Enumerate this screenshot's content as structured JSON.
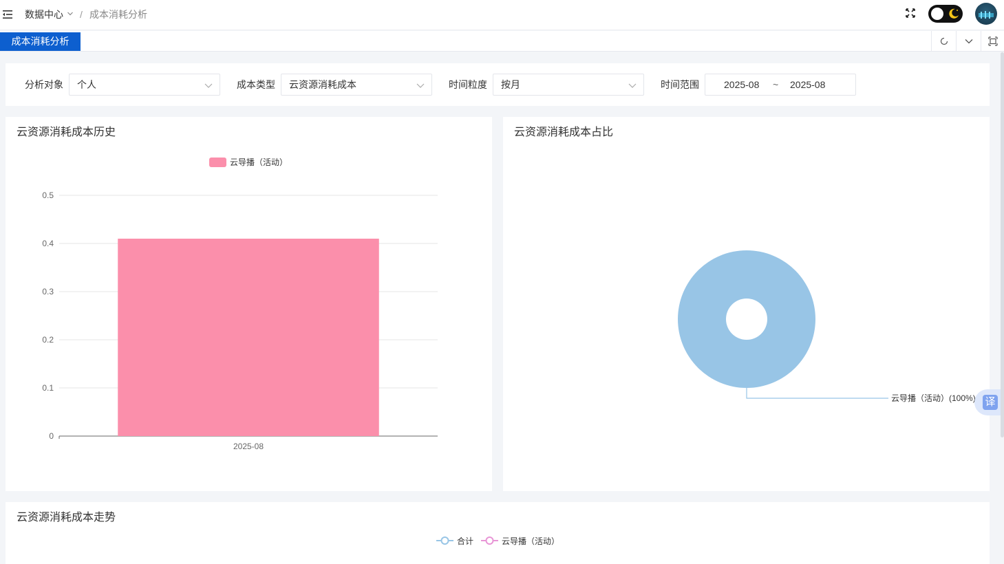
{
  "header": {
    "breadcrumb_root": "数据中心",
    "breadcrumb_sep": "/",
    "breadcrumb_current": "成本消耗分析"
  },
  "tabs": [
    {
      "label": "成本消耗分析",
      "active": true
    }
  ],
  "filters": {
    "target_label": "分析对象",
    "target_value": "个人",
    "cost_type_label": "成本类型",
    "cost_type_value": "云资源消耗成本",
    "granularity_label": "时间粒度",
    "granularity_value": "按月",
    "range_label": "时间范围",
    "range_start": "2025-08",
    "range_sep": "~",
    "range_end": "2025-08"
  },
  "colors": {
    "accent": "#0d5fcf",
    "bar": "#fb8fab",
    "pie": "#98c5e6",
    "line_total": "#98c5e6",
    "line_series": "#e895d6"
  },
  "translate_label": "译",
  "chart_data": [
    {
      "type": "bar",
      "title": "云资源消耗成本历史",
      "categories": [
        "2025-08"
      ],
      "series": [
        {
          "name": "云导播（活动）",
          "values": [
            0.41
          ]
        }
      ],
      "yticks": [
        "0",
        "0.1",
        "0.2",
        "0.3",
        "0.4",
        "0.5"
      ],
      "ylim": [
        0,
        0.5
      ],
      "grid": true,
      "legend": "top-center"
    },
    {
      "type": "pie",
      "title": "云资源消耗成本占比",
      "slices": [
        {
          "name": "云导播（活动）",
          "value": 100,
          "label": "云导播（活动）(100%)"
        }
      ],
      "legend": "none"
    },
    {
      "type": "line",
      "title": "云资源消耗成本走势",
      "series": [
        {
          "name": "合计"
        },
        {
          "name": "云导播（活动）"
        }
      ],
      "legend": "top-center"
    }
  ]
}
